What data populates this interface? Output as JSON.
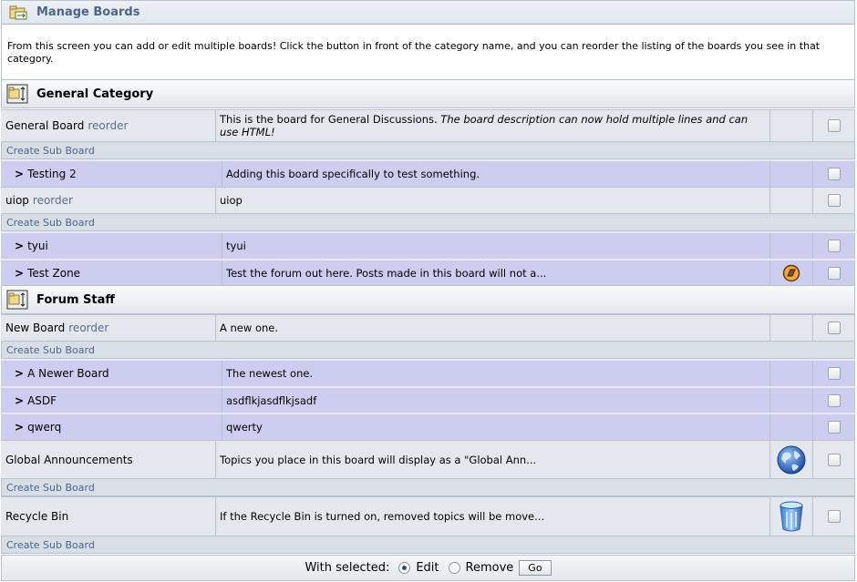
{
  "header": {
    "title": "Manage Boards"
  },
  "description": "From this screen you can add or edit multiple boards! Click the button in front of the category name, and you can reorder the listing of the boards you see in that category.",
  "categories": [
    {
      "name": "General Category",
      "boards": [
        {
          "name": "General Board",
          "reorder": "reorder",
          "desc_plain": "This is the board for General Discussions. ",
          "desc_italic": "The board description can now hold multiple lines and can use HTML!",
          "sub_label": "Create Sub Board"
        },
        {
          "name": "Testing 2",
          "desc": "Adding this board specifically to test something."
        },
        {
          "name": "uiop",
          "reorder": "reorder",
          "desc": "uiop",
          "sub_label": "Create Sub Board"
        },
        {
          "name": "tyui",
          "desc": "tyui"
        },
        {
          "name": "Test Zone",
          "desc": "Test the forum out here. Posts made in this board will not a...",
          "icon": "no-post-count-icon"
        }
      ]
    },
    {
      "name": "Forum Staff",
      "boards": [
        {
          "name": "New Board",
          "reorder": "reorder",
          "desc": "A new one.",
          "sub_label": "Create Sub Board"
        },
        {
          "name": "A Newer Board",
          "desc": "The newest one."
        },
        {
          "name": "ASDF",
          "desc": "asdflkjasdflkjsadf"
        },
        {
          "name": "qwerq",
          "desc": "qwerty"
        },
        {
          "name": "Global Announcements",
          "desc": "Topics you place in this board will display as a \"Global Ann...",
          "icon": "globe-icon",
          "sub_label": "Create Sub Board"
        },
        {
          "name": "Recycle Bin",
          "desc": "If the Recycle Bin is turned on, removed topics will be move...",
          "icon": "recycle-bin-icon",
          "sub_label": "Create Sub Board"
        }
      ]
    }
  ],
  "child_marker": ">",
  "footer": {
    "label": "With selected:",
    "option_edit": "Edit",
    "option_remove": "Remove",
    "selected": "Edit",
    "go_label": "Go"
  },
  "colors": {
    "title_text": "#4c6689",
    "child_row": "#cdcdf0",
    "parent_row": "#e4e8ee",
    "border": "#b9c3d0"
  }
}
